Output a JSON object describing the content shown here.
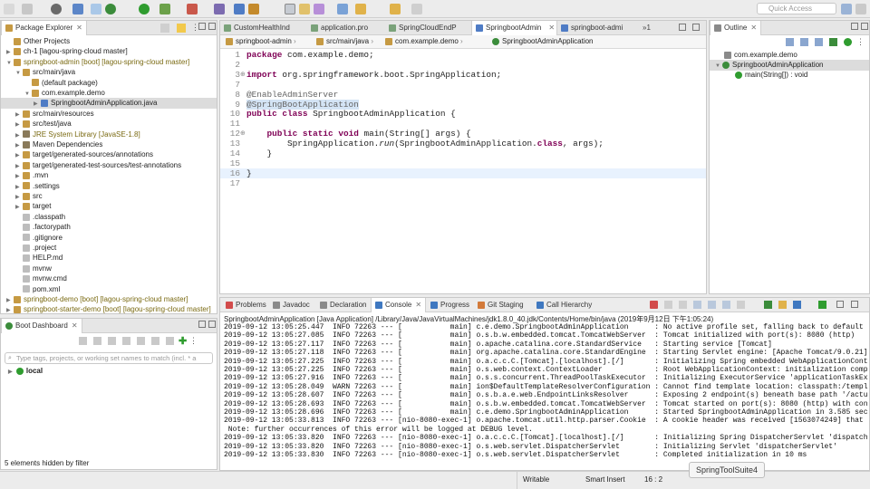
{
  "toolbar": {
    "quick_access_placeholder": "Quick Access"
  },
  "package_explorer": {
    "tab_label": "Package Explorer",
    "items": [
      {
        "label": "Other Projects",
        "indent": 0
      },
      {
        "label": "ch-1 [lagou-spring-cloud master]",
        "indent": 0
      },
      {
        "label": "springboot-admin [boot] [lagou-spring-cloud master]",
        "indent": 0
      },
      {
        "label": "src/main/java",
        "indent": 1
      },
      {
        "label": "(default package)",
        "indent": 2
      },
      {
        "label": "com.example.demo",
        "indent": 2
      },
      {
        "label": "SpringbootAdminApplication.java",
        "indent": 3
      },
      {
        "label": "src/main/resources",
        "indent": 1
      },
      {
        "label": "src/test/java",
        "indent": 1
      },
      {
        "label": "JRE System Library [JavaSE-1.8]",
        "indent": 1
      },
      {
        "label": "Maven Dependencies",
        "indent": 1
      },
      {
        "label": "target/generated-sources/annotations",
        "indent": 1
      },
      {
        "label": "target/generated-test-sources/test-annotations",
        "indent": 1
      },
      {
        "label": ".mvn",
        "indent": 1
      },
      {
        "label": ".settings",
        "indent": 1
      },
      {
        "label": "src",
        "indent": 1
      },
      {
        "label": "target",
        "indent": 1
      },
      {
        "label": ".classpath",
        "indent": 1
      },
      {
        "label": ".factorypath",
        "indent": 1
      },
      {
        "label": ".gitignore",
        "indent": 1
      },
      {
        "label": ".project",
        "indent": 1
      },
      {
        "label": "HELP.md",
        "indent": 1
      },
      {
        "label": "mvnw",
        "indent": 1
      },
      {
        "label": "mvnw.cmd",
        "indent": 1
      },
      {
        "label": "pom.xml",
        "indent": 1
      },
      {
        "label": "springboot-demo [boot] [lagou-spring-cloud master]",
        "indent": 0
      },
      {
        "label": "springboot-starter-demo [boot] [lagou-spring-cloud master]",
        "indent": 0
      }
    ]
  },
  "boot_dashboard": {
    "tab_label": "Boot Dashboard",
    "filter_placeholder": "Type tags, projects, or working set names to match (incl. * a",
    "local_label": "local",
    "hidden_text": "5 elements hidden by filter"
  },
  "editor": {
    "tabs": [
      "CustomHealthInd",
      "application.pro",
      "SpringCloudEndP",
      "SpringbootAdmin",
      "springboot-admi"
    ],
    "overflow_count": "1",
    "breadcrumb": [
      "springboot-admin",
      "src/main/java",
      "com.example.demo",
      "SpringbootAdminApplication"
    ],
    "lines": [
      {
        "n": "1",
        "text": "package com.example.demo;"
      },
      {
        "n": "2",
        "text": ""
      },
      {
        "n": "3",
        "text": "import org.springframework.boot.SpringApplication;"
      },
      {
        "n": "7",
        "text": ""
      },
      {
        "n": "8",
        "text": "@EnableAdminServer"
      },
      {
        "n": "9",
        "text": "@SpringBootApplication"
      },
      {
        "n": "10",
        "text": "public class SpringbootAdminApplication {"
      },
      {
        "n": "11",
        "text": ""
      },
      {
        "n": "12",
        "text": "    public static void main(String[] args) {"
      },
      {
        "n": "13",
        "text": "        SpringApplication.run(SpringbootAdminApplication.class, args);"
      },
      {
        "n": "14",
        "text": "    }"
      },
      {
        "n": "15",
        "text": ""
      },
      {
        "n": "16",
        "text": "}"
      },
      {
        "n": "17",
        "text": ""
      }
    ]
  },
  "outline": {
    "tab_label": "Outline",
    "items": [
      "com.example.demo",
      "SpringbootAdminApplication",
      "main(String[]) : void"
    ]
  },
  "console": {
    "tabs": [
      "Problems",
      "Javadoc",
      "Declaration",
      "Console",
      "Progress",
      "Git Staging",
      "Call Hierarchy"
    ],
    "active_tab": "Console",
    "header": "SpringbootAdminApplication [Java Application] /Library/Java/JavaVirtualMachines/jdk1.8.0_40.jdk/Contents/Home/bin/java (2019年9月12日 下午1:05:24)",
    "lines": [
      "2019-09-12 13:05:25.447  INFO 72263 --- [           main] c.e.demo.SpringbootAdminApplication      : No active profile set, falling back to default",
      "2019-09-12 13:05:27.085  INFO 72263 --- [           main] o.s.b.w.embedded.tomcat.TomcatWebServer  : Tomcat initialized with port(s): 8080 (http)",
      "2019-09-12 13:05:27.117  INFO 72263 --- [           main] o.apache.catalina.core.StandardService   : Starting service [Tomcat]",
      "2019-09-12 13:05:27.118  INFO 72263 --- [           main] org.apache.catalina.core.StandardEngine  : Starting Servlet engine: [Apache Tomcat/9.0.21]",
      "2019-09-12 13:05:27.225  INFO 72263 --- [           main] o.a.c.c.C.[Tomcat].[localhost].[/]       : Initializing Spring embedded WebApplicationCont",
      "2019-09-12 13:05:27.225  INFO 72263 --- [           main] o.s.web.context.ContextLoader            : Root WebApplicationContext: initialization comp",
      "2019-09-12 13:05:27.916  INFO 72263 --- [           main] o.s.s.concurrent.ThreadPoolTaskExecutor  : Initializing ExecutorService 'applicationTaskEx",
      "2019-09-12 13:05:28.049  WARN 72263 --- [           main] ion$DefaultTemplateResolverConfiguration : Cannot find template location: classpath:/templ",
      "2019-09-12 13:05:28.607  INFO 72263 --- [           main] o.s.b.a.e.web.EndpointLinksResolver      : Exposing 2 endpoint(s) beneath base path '/actu",
      "2019-09-12 13:05:28.693  INFO 72263 --- [           main] o.s.b.w.embedded.tomcat.TomcatWebServer  : Tomcat started on port(s): 8080 (http) with con",
      "2019-09-12 13:05:28.696  INFO 72263 --- [           main] c.e.demo.SpringbootAdminApplication      : Started SpringbootAdminApplication in 3.585 sec",
      "2019-09-12 13:05:33.813  INFO 72263 --- [nio-8080-exec-1] o.apache.tomcat.util.http.parser.Cookie  : A cookie header was received [1563074249] that",
      " Note: further occurrences of this error will be logged at DEBUG level.",
      "2019-09-12 13:05:33.820  INFO 72263 --- [nio-8080-exec-1] o.a.c.c.C.[Tomcat].[localhost].[/]       : Initializing Spring DispatcherServlet 'dispatch",
      "2019-09-12 13:05:33.820  INFO 72263 --- [nio-8080-exec-1] o.s.web.servlet.DispatcherServlet        : Initializing Servlet 'dispatcherServlet'",
      "2019-09-12 13:05:33.830  INFO 72263 --- [nio-8080-exec-1] o.s.web.servlet.DispatcherServlet        : Completed initialization in 10 ms"
    ]
  },
  "status": {
    "writable": "Writable",
    "insert_mode": "Smart Insert",
    "position": "16 : 2",
    "app_tooltip": "SpringToolSuite4"
  },
  "colors": {
    "selection": "#dcdcdc",
    "keyword": "#7f0055",
    "annotation": "#646464",
    "current_line": "#e8f2fe",
    "boot_label": "#7a6a12"
  }
}
